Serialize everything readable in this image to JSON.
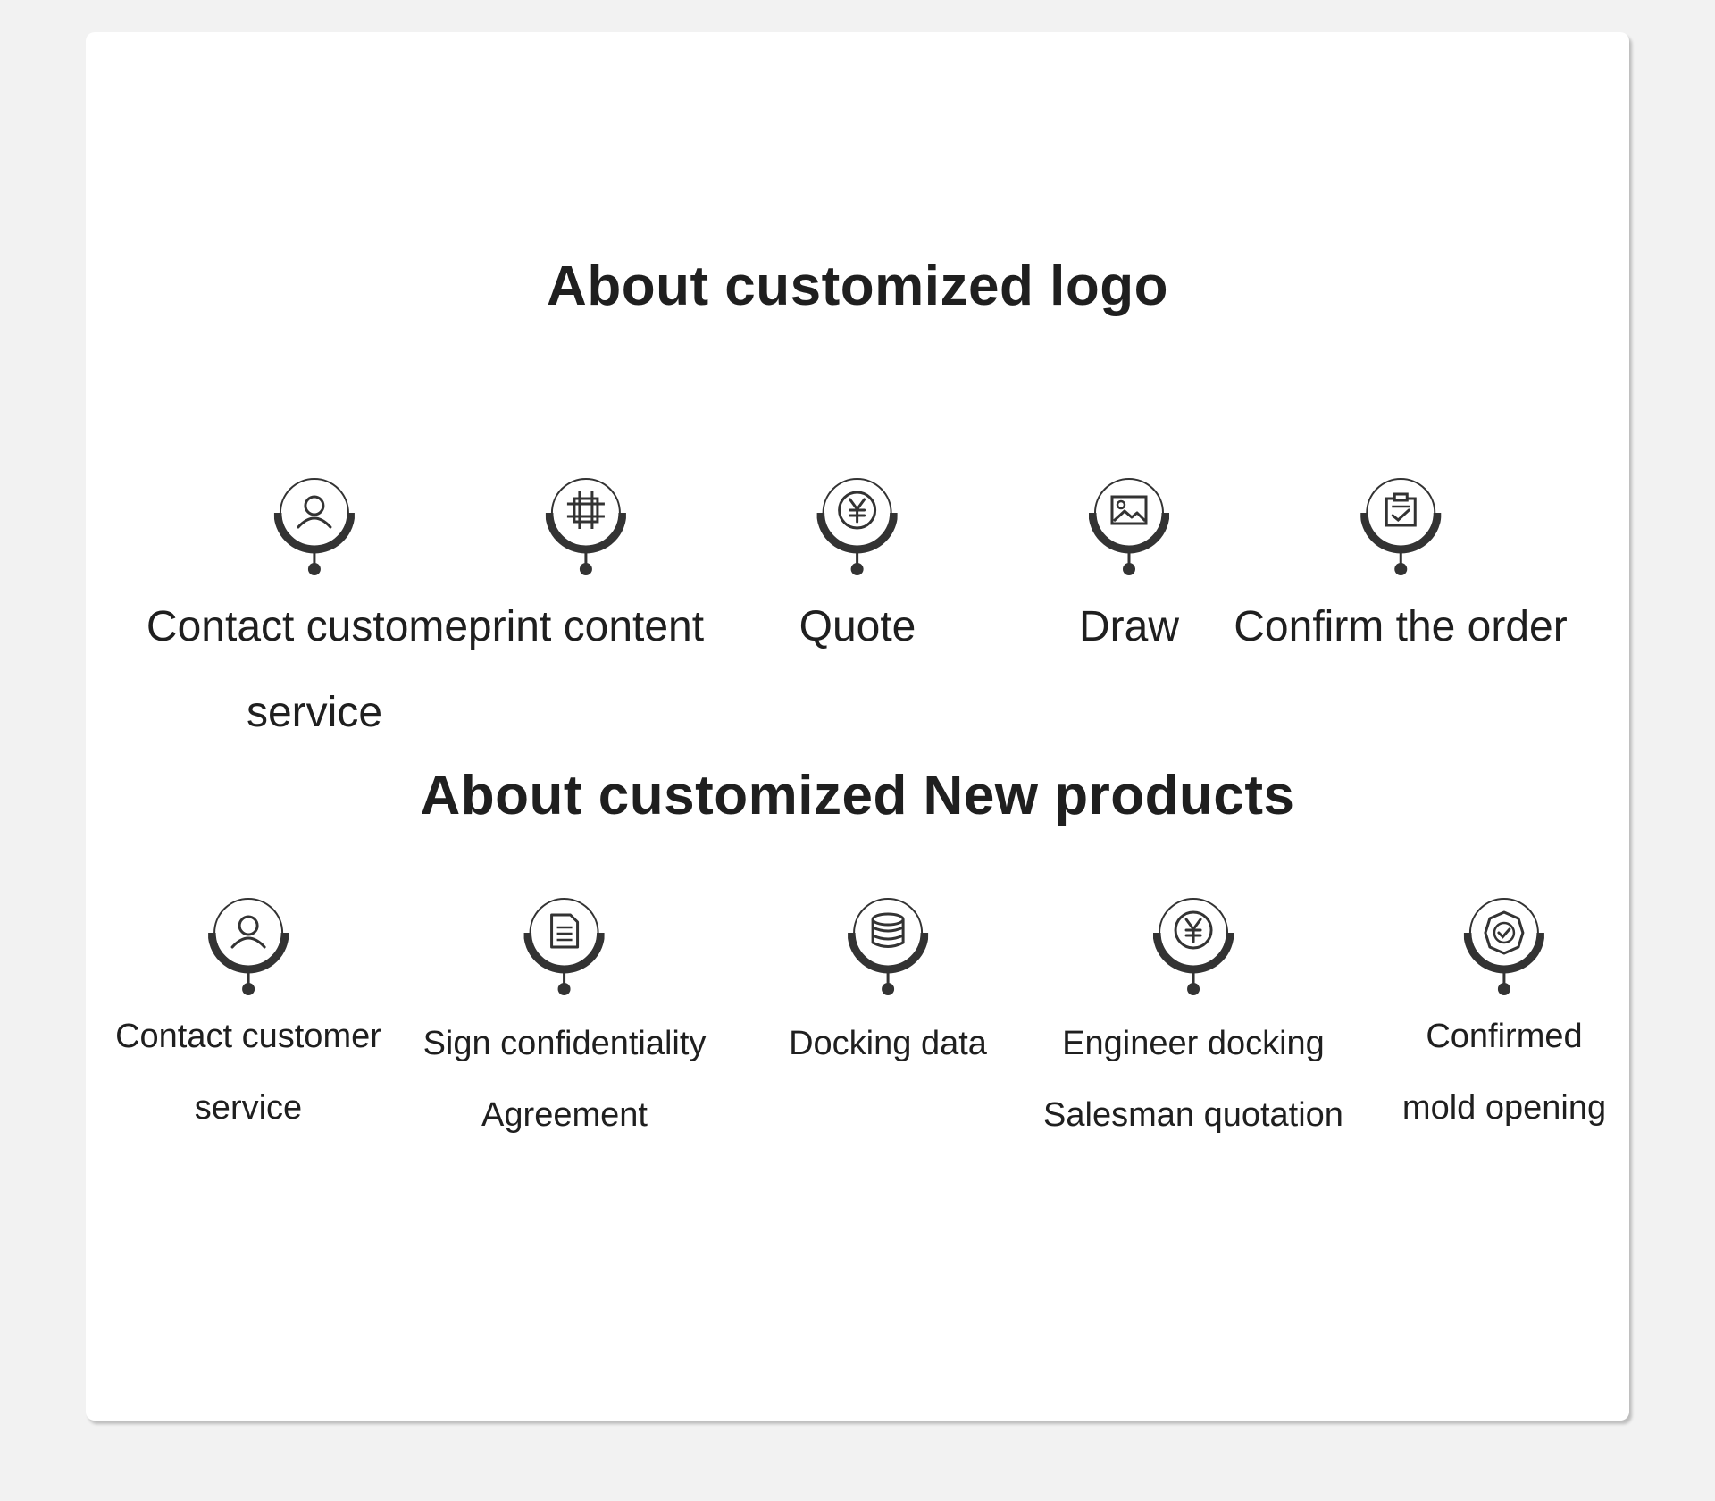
{
  "logo_section": {
    "title": "About customized logo",
    "steps": [
      {
        "icon": "user-icon",
        "lines": [
          "Contact customer",
          "service"
        ]
      },
      {
        "icon": "crop-icon",
        "lines": [
          "print content"
        ]
      },
      {
        "icon": "yen-icon",
        "lines": [
          "Quote"
        ]
      },
      {
        "icon": "image-icon",
        "lines": [
          "Draw"
        ]
      },
      {
        "icon": "clipboard-check-icon",
        "lines": [
          "Confirm the order"
        ]
      }
    ]
  },
  "products_section": {
    "title": "About customized New products",
    "steps": [
      {
        "icon": "user-icon",
        "lines": [
          "Contact customer",
          "service"
        ]
      },
      {
        "icon": "document-icon",
        "lines": [
          "Sign confidentiality",
          "Agreement"
        ]
      },
      {
        "icon": "database-icon",
        "lines": [
          "Docking data"
        ]
      },
      {
        "icon": "yen-icon",
        "lines": [
          "Engineer docking",
          "Salesman quotation"
        ]
      },
      {
        "icon": "badge-check-icon",
        "lines": [
          "Confirmed",
          "mold opening"
        ]
      }
    ]
  },
  "colors": {
    "text": "#1f1f1f",
    "icon": "#333333",
    "card": "#ffffff",
    "background": "#f2f2f2"
  }
}
